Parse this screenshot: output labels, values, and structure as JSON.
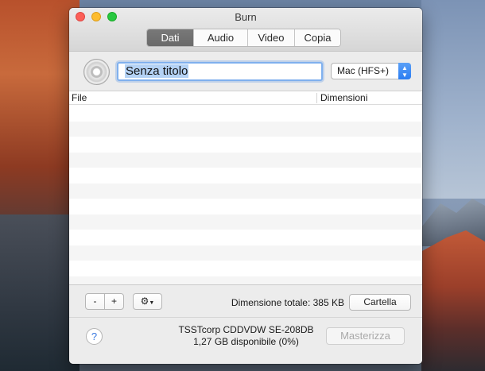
{
  "window": {
    "title": "Burn"
  },
  "tabs": [
    {
      "label": "Dati",
      "active": true
    },
    {
      "label": "Audio",
      "active": false
    },
    {
      "label": "Video",
      "active": false
    },
    {
      "label": "Copia",
      "active": false
    }
  ],
  "disc": {
    "name_value": "Senza titolo",
    "filesystem_selected": "Mac (HFS+)"
  },
  "table": {
    "columns": [
      "File",
      "Dimensioni"
    ],
    "rows": []
  },
  "toolbar": {
    "remove_label": "-",
    "add_label": "+",
    "total_size_text": "Dimensione totale: 385 KB",
    "folder_button_label": "Cartella"
  },
  "status": {
    "help_label": "?",
    "drive_name": "TSSTcorp CDDVDW SE-208DB",
    "drive_space": "1,27 GB disponibile (0%)",
    "burn_button_label": "Masterizza",
    "burn_button_enabled": false
  },
  "icons": {
    "disc": "cd-disc-icon",
    "actions": "gear-icon",
    "actions_menu": "chevron-down-icon",
    "popup_arrows": "up-down-arrows-icon"
  },
  "colors": {
    "tab_active": "#6f6f6f",
    "focus_ring": "#7fb0ee",
    "selection": "#b4d2f5",
    "select_arrows": "#2b7df2",
    "close": "#fc5f57",
    "minimize": "#fdbc2e",
    "maximize": "#28c840"
  }
}
